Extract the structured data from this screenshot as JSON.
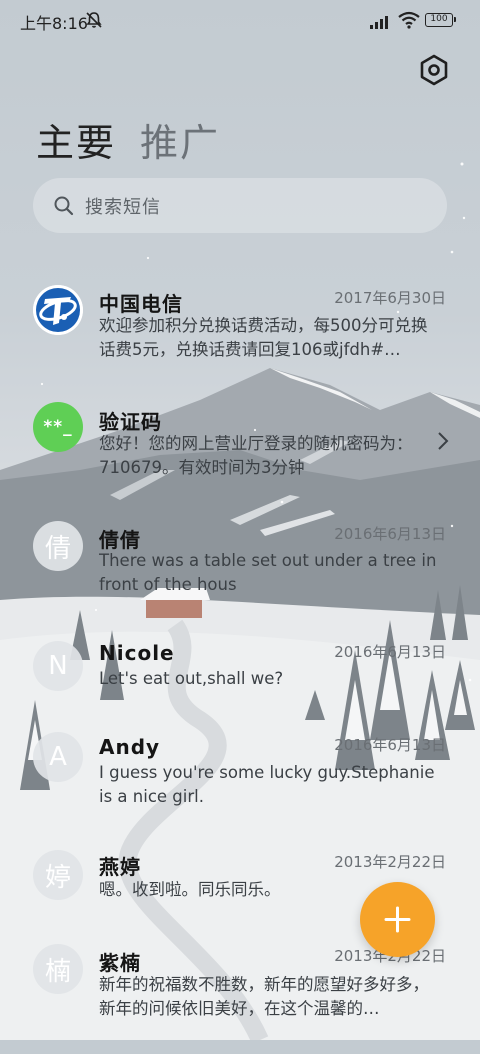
{
  "status_bar": {
    "time": "上午8:16",
    "battery": "100",
    "icons": [
      "mute-icon",
      "signal-icon",
      "wifi-icon",
      "battery-icon"
    ]
  },
  "header": {
    "settings_icon": "settings-hexagon-icon",
    "tabs": [
      {
        "label": "主要",
        "active": true
      },
      {
        "label": "推广",
        "active": false
      }
    ]
  },
  "search": {
    "icon": "search-icon",
    "placeholder": "搜索短信"
  },
  "conversations": [
    {
      "name": "中国电信",
      "date": "2017年6月30日",
      "preview": "欢迎参加积分兑换话费活动，每500分可兑换话费5元，兑换话费请回复106或jfdh#…",
      "avatar": "china-telecom-logo",
      "avatar_letter": ""
    },
    {
      "name": "验证码",
      "date": "",
      "preview": "您好！您的网上营业厅登录的随机密码为：710679。有效时间为3分钟",
      "avatar": "verification-code-icon",
      "avatar_letter": "**_"
    },
    {
      "name": "倩倩",
      "date": "2016年6月13日",
      "preview": "There was a table set out under a tree in front of the hous",
      "avatar": "letter",
      "avatar_letter": "倩"
    },
    {
      "name": "Nicole",
      "date": "2016年6月13日",
      "preview": "Let's eat out,shall we?",
      "avatar": "letter",
      "avatar_letter": "N"
    },
    {
      "name": "Andy",
      "date": "2016年6月13日",
      "preview": "I guess you're some lucky guy.Stephanie is a nice girl.",
      "avatar": "letter",
      "avatar_letter": "A"
    },
    {
      "name": "燕婷",
      "date": "2013年2月22日",
      "preview": "嗯。收到啦。同乐同乐。",
      "avatar": "letter",
      "avatar_letter": "婷"
    },
    {
      "name": "紫楠",
      "date": "2013年2月22日",
      "preview": "新年的祝福数不胜数，新年的愿望好多好多，新年的问候依旧美好，在这个温馨的…",
      "avatar": "letter",
      "avatar_letter": "楠"
    }
  ],
  "fab": {
    "icon": "plus-icon"
  },
  "colors": {
    "fab": "#f6a329",
    "verification_avatar": "#5fcf55",
    "telecom_blue": "#1a5fb4"
  }
}
